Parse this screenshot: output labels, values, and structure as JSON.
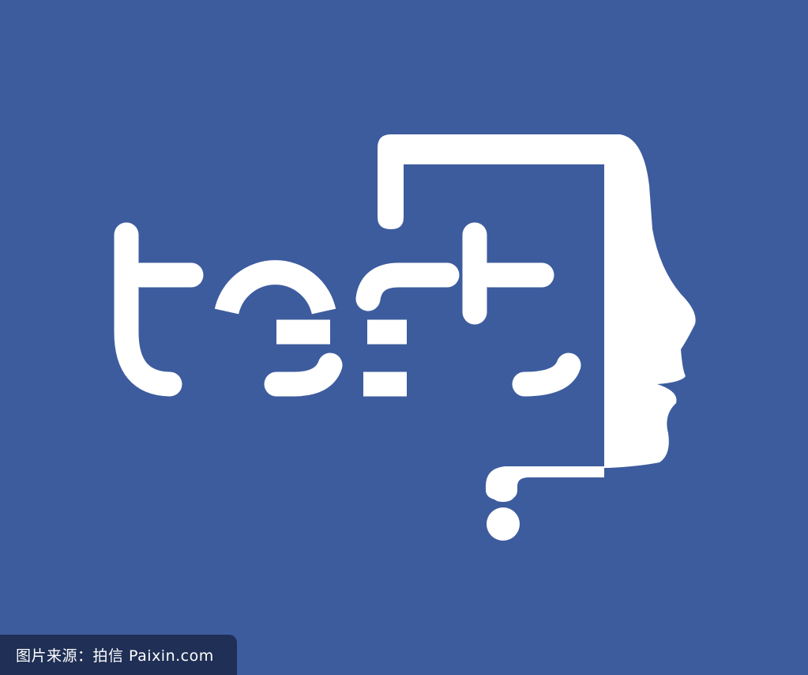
{
  "colors": {
    "background": "#3d5c9e",
    "foreground": "#ffffff",
    "credit_bar": "#1f2f55"
  },
  "logo": {
    "wordmark": "test",
    "icons": [
      "face-profile-icon",
      "question-mark-icon"
    ]
  },
  "watermark": {
    "text": "图片来源：拍信 Paixin.com"
  }
}
